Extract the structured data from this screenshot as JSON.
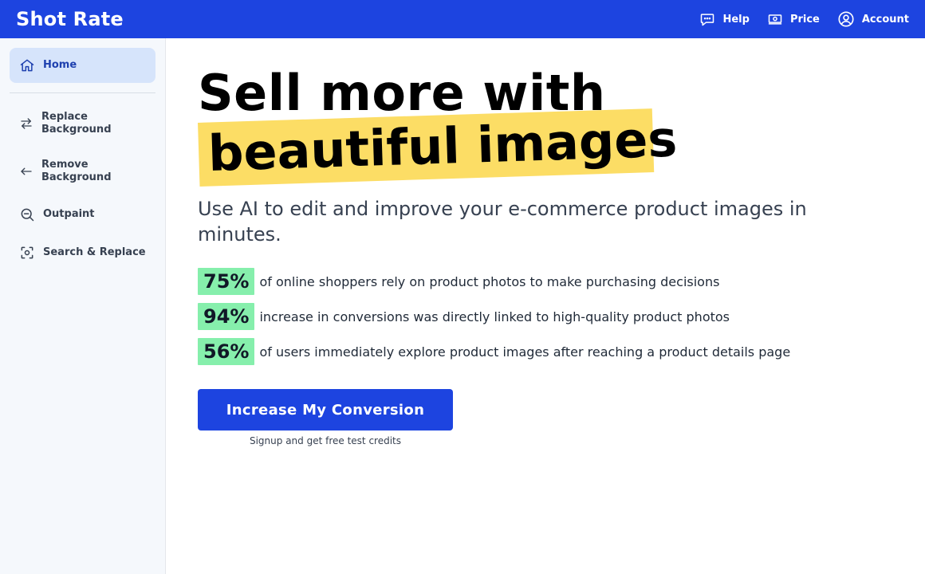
{
  "header": {
    "brand": "Shot Rate",
    "nav": [
      {
        "label": "Help",
        "icon": "chat-bubble-icon"
      },
      {
        "label": "Price",
        "icon": "money-icon"
      },
      {
        "label": "Account",
        "icon": "user-circle-icon"
      }
    ]
  },
  "sidebar": {
    "items": [
      {
        "label": "Home",
        "icon": "home-icon",
        "active": true
      },
      {
        "label_line1": "Replace",
        "label_line2": "Background",
        "icon": "swap-arrows-icon"
      },
      {
        "label_line1": "Remove",
        "label_line2": "Background",
        "icon": "arrow-left-icon"
      },
      {
        "label": "Outpaint",
        "icon": "zoom-out-icon"
      },
      {
        "label": "Search & Replace",
        "icon": "scan-focus-icon"
      }
    ]
  },
  "hero": {
    "line1": "Sell more with",
    "line2": "beautiful images",
    "subtitle": "Use AI to edit and improve your e-commerce product images in minutes."
  },
  "stats": [
    {
      "value": "75%",
      "text": "of online shoppers rely on product photos to make purchasing decisions"
    },
    {
      "value": "94%",
      "text": "increase in conversions was directly linked to high-quality product photos"
    },
    {
      "value": "56%",
      "text": "of users immediately explore product images after reaching a product details page"
    }
  ],
  "cta": {
    "button_label": "Increase My Conversion",
    "note": "Signup and get free test credits"
  },
  "colors": {
    "primary": "#1d44e0",
    "highlight_yellow": "#fcdd65",
    "stat_green": "#86efac",
    "sidebar_active": "#d6e4fb"
  }
}
